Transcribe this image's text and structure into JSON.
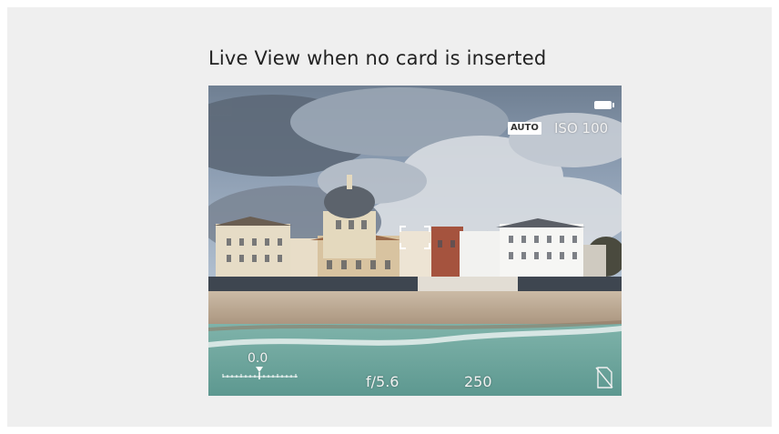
{
  "caption": "Live View when no card is inserted",
  "overlay": {
    "battery_icon": "battery-full-icon",
    "iso_mode": "AUTO",
    "iso": "ISO 100",
    "exposure_comp": "0.0",
    "aperture": "f/5.6",
    "shutter": "250",
    "no_card_icon": "no-card-icon",
    "focus_icon": "focus-frame-icon"
  },
  "colors": {
    "panel": "#efefef",
    "overlay_text": "#f2f2f2",
    "sea": "#6fa8a0",
    "sand": "#c8b8a2",
    "sky": "#8ea4bc"
  }
}
